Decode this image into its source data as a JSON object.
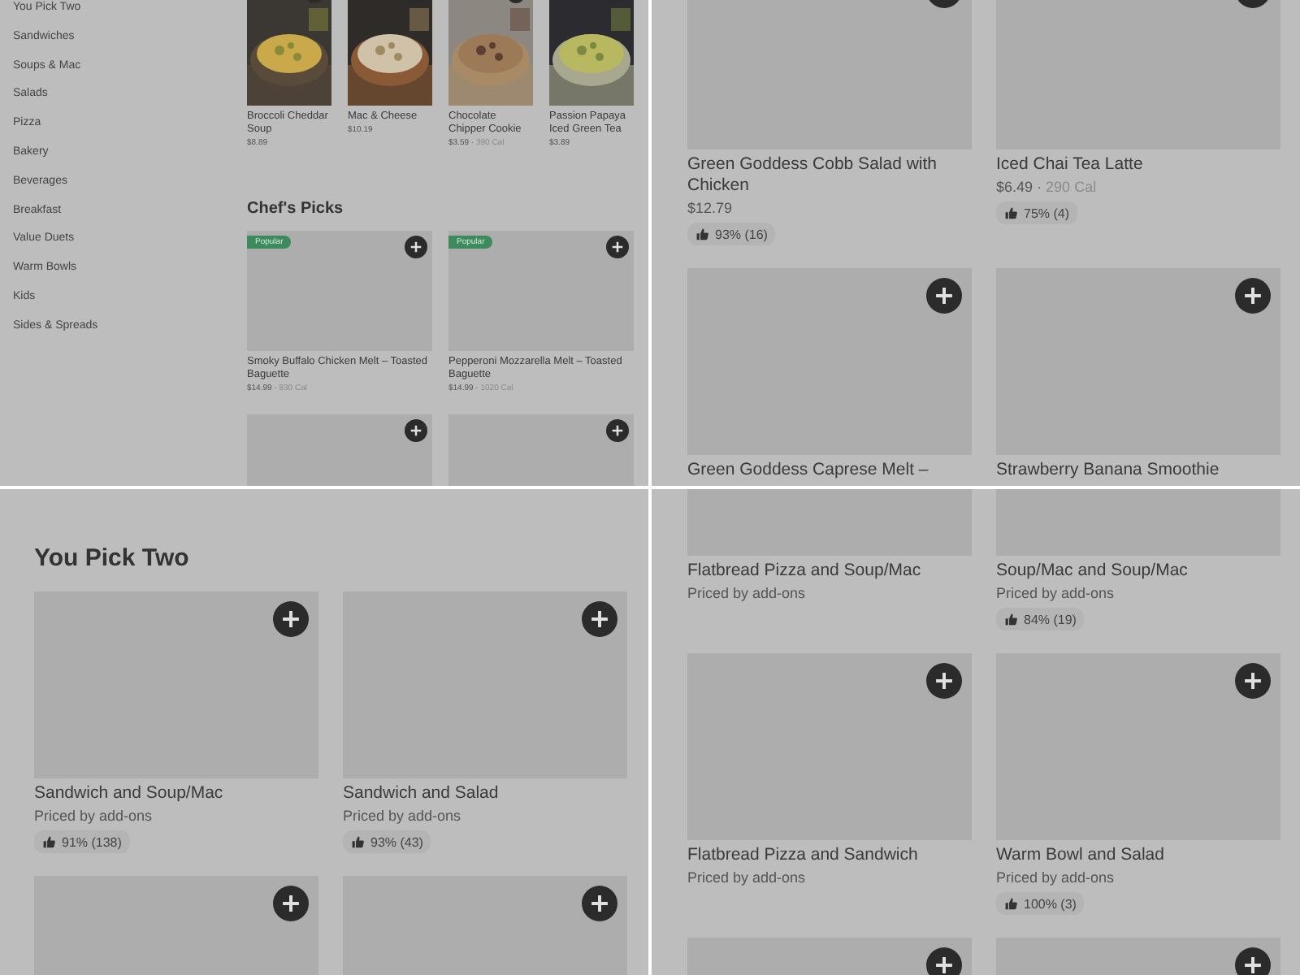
{
  "panes": [
    {
      "kind": "menu_overview",
      "sidebar": {
        "items": [
          "You Pick Two",
          "Sandwiches",
          "Soups & Mac",
          "Salads",
          "Pizza",
          "Bakery",
          "Beverages",
          "Breakfast",
          "Value Duets",
          "Warm Bowls",
          "Kids",
          "Sides & Spreads"
        ]
      },
      "featured": [
        {
          "title": "Broccoli Cheddar Soup",
          "price": "$8.89"
        },
        {
          "title": "Mac & Cheese",
          "price": "$10.19"
        },
        {
          "title": "Chocolate Chipper Cookie",
          "price": "$3.59 ·",
          "calories": "390 Cal"
        },
        {
          "title": "Passion Papaya Iced Green Tea",
          "price": "$3.89"
        }
      ],
      "sections": [
        {
          "title": "Chef's Picks",
          "cards": [
            {
              "kind": "item",
              "badge": "Popular",
              "title": "Smoky Buffalo Chicken Melt – Toasted Baguette",
              "price": "$14.99 ·",
              "calories": "830 Cal"
            },
            {
              "kind": "item",
              "badge": "Popular",
              "title": "Pepperoni Mozzarella Melt – Toasted Baguette",
              "price": "$14.99 ·",
              "calories": "1020 Cal"
            },
            {
              "kind": "image_only"
            },
            {
              "kind": "image_only"
            }
          ]
        }
      ]
    },
    {
      "kind": "item_grid",
      "sections": [
        {
          "cards": [
            {
              "kind": "item",
              "title": "Green Goddess Cobb Salad with Chicken",
              "price": "$12.79",
              "rating": "93% (16)"
            },
            {
              "kind": "item",
              "title": "Iced Chai Tea Latte",
              "price": "$6.49 ·",
              "calories": "290 Cal",
              "rating": "75% (4)"
            },
            {
              "kind": "item",
              "title": "Green Goddess Caprese Melt –"
            },
            {
              "kind": "item",
              "title": "Strawberry Banana Smoothie"
            }
          ]
        }
      ]
    },
    {
      "kind": "item_grid",
      "sections": [
        {
          "title": "You Pick Two",
          "cards": [
            {
              "kind": "item",
              "title": "Sandwich and Soup/Mac",
              "subtitle": "Priced by add-ons",
              "rating": "91% (138)"
            },
            {
              "kind": "item",
              "title": "Sandwich and Salad",
              "subtitle": "Priced by add-ons",
              "rating": "93% (43)"
            },
            {
              "kind": "image_only"
            },
            {
              "kind": "image_only"
            }
          ]
        }
      ]
    },
    {
      "kind": "item_grid",
      "sections": [
        {
          "cards": [
            {
              "kind": "item",
              "title": "Flatbread Pizza and Soup/Mac",
              "subtitle": "Priced by add-ons"
            },
            {
              "kind": "item",
              "title": "Soup/Mac and Soup/Mac",
              "subtitle": "Priced by add-ons",
              "rating": "84% (19)"
            },
            {
              "kind": "item",
              "title": "Flatbread Pizza and Sandwich",
              "subtitle": "Priced by add-ons"
            },
            {
              "kind": "item",
              "title": "Warm Bowl and Salad",
              "subtitle": "Priced by add-ons",
              "rating": "100% (3)"
            },
            {
              "kind": "image_only"
            },
            {
              "kind": "image_only"
            }
          ]
        }
      ]
    }
  ]
}
